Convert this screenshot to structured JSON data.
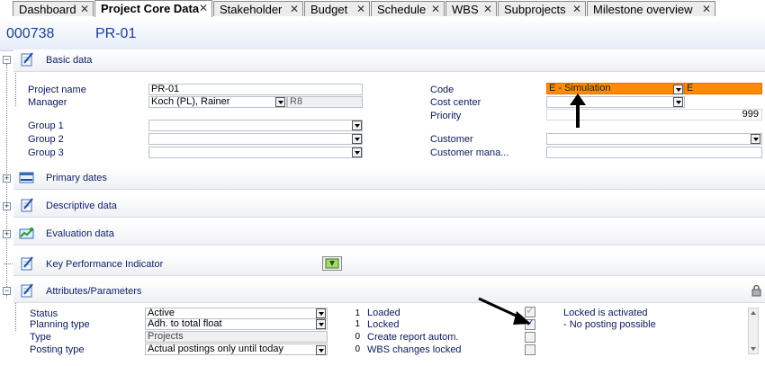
{
  "tabs": [
    {
      "label": "Dashboard",
      "close": "✕"
    },
    {
      "label": "Project Core Data",
      "close": "✕"
    },
    {
      "label": "Stakeholder",
      "close": "✕"
    },
    {
      "label": "Budget",
      "close": "✕"
    },
    {
      "label": "Schedule",
      "close": "✕"
    },
    {
      "label": "WBS",
      "close": "✕"
    },
    {
      "label": "Subprojects",
      "close": "✕"
    },
    {
      "label": "Milestone overview",
      "close": "✕"
    }
  ],
  "active_tab": "Project Core Data",
  "header": {
    "number": "000738",
    "code": "PR-01"
  },
  "sections": {
    "basic": {
      "label": "Basic data",
      "expander": "−"
    },
    "primary_dates": {
      "label": "Primary dates",
      "expander": "+"
    },
    "descriptive": {
      "label": "Descriptive data",
      "expander": "+"
    },
    "evaluation": {
      "label": "Evaluation data",
      "expander": "+"
    },
    "kpi": {
      "label": "Key Performance Indicator"
    },
    "attributes": {
      "label": "Attributes/Parameters",
      "expander": "−"
    }
  },
  "basic": {
    "project_name": {
      "label": "Project name",
      "value": "PR-01"
    },
    "manager": {
      "label": "Manager",
      "value": "Koch (PL), Rainer",
      "suffix": "R8"
    },
    "group1": {
      "label": "Group 1",
      "value": ""
    },
    "group2": {
      "label": "Group 2",
      "value": ""
    },
    "group3": {
      "label": "Group 3",
      "value": ""
    },
    "code": {
      "label": "Code",
      "value": "E - Simulation",
      "suffix": "E"
    },
    "cost_center": {
      "label": "Cost center",
      "value": ""
    },
    "priority": {
      "label": "Priority",
      "value": "999"
    },
    "customer": {
      "label": "Customer",
      "value": ""
    },
    "customer_manager": {
      "label": "Customer mana...",
      "value": ""
    }
  },
  "attributes": {
    "status": {
      "label": "Status",
      "value": "Active",
      "num": "1"
    },
    "planning_type": {
      "label": "Planning type",
      "value": "Adh. to total float",
      "num": "1"
    },
    "type": {
      "label": "Type",
      "value": "Projects",
      "num": "0"
    },
    "posting_type": {
      "label": "Posting type",
      "value": "Actual postings only until today",
      "num": "0"
    },
    "loaded": {
      "label": "Loaded",
      "checked": true,
      "disabled": true
    },
    "locked": {
      "label": "Locked",
      "checked": true
    },
    "create_report": {
      "label": "Create report autom.",
      "checked": false
    },
    "wbs_changes_locked": {
      "label": "WBS changes locked",
      "checked": false
    },
    "note_line1": "Locked is activated",
    "note_line2": "- No posting possible"
  },
  "colors": {
    "code_highlight": "#ff8c00",
    "accent": "#1a3f8f"
  }
}
